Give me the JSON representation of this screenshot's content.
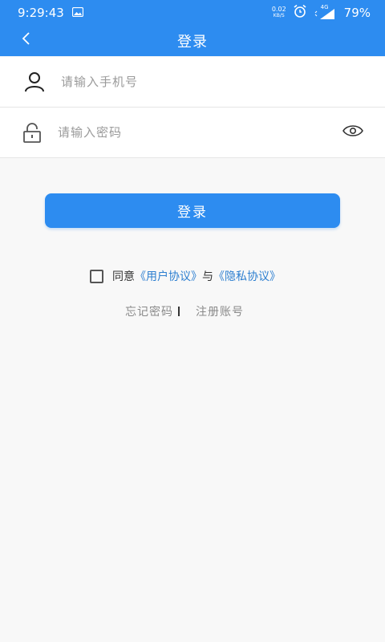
{
  "status_bar": {
    "time": "9:29:43",
    "net_speed_value": "0.02",
    "net_speed_unit": "KB/S",
    "network": "4G",
    "battery": "79%"
  },
  "header": {
    "title": "登录",
    "back_icon": "chevron-left-icon"
  },
  "form": {
    "phone_placeholder": "请输入手机号",
    "phone_value": "",
    "password_placeholder": "请输入密码",
    "password_value": "",
    "user_icon": "user-icon",
    "lock_icon": "lock-icon",
    "eye_icon": "eye-icon"
  },
  "login_button_label": "登录",
  "agreement": {
    "prefix": "同意",
    "user_agreement": "《用户协议》",
    "conjunction": "与",
    "privacy_policy": "《隐私协议》"
  },
  "links": {
    "forgot_password": "忘记密码",
    "register": "注册账号"
  },
  "colors": {
    "primary": "#2d8cf0",
    "link": "#2d7fd0",
    "background": "#f8f8f8"
  }
}
